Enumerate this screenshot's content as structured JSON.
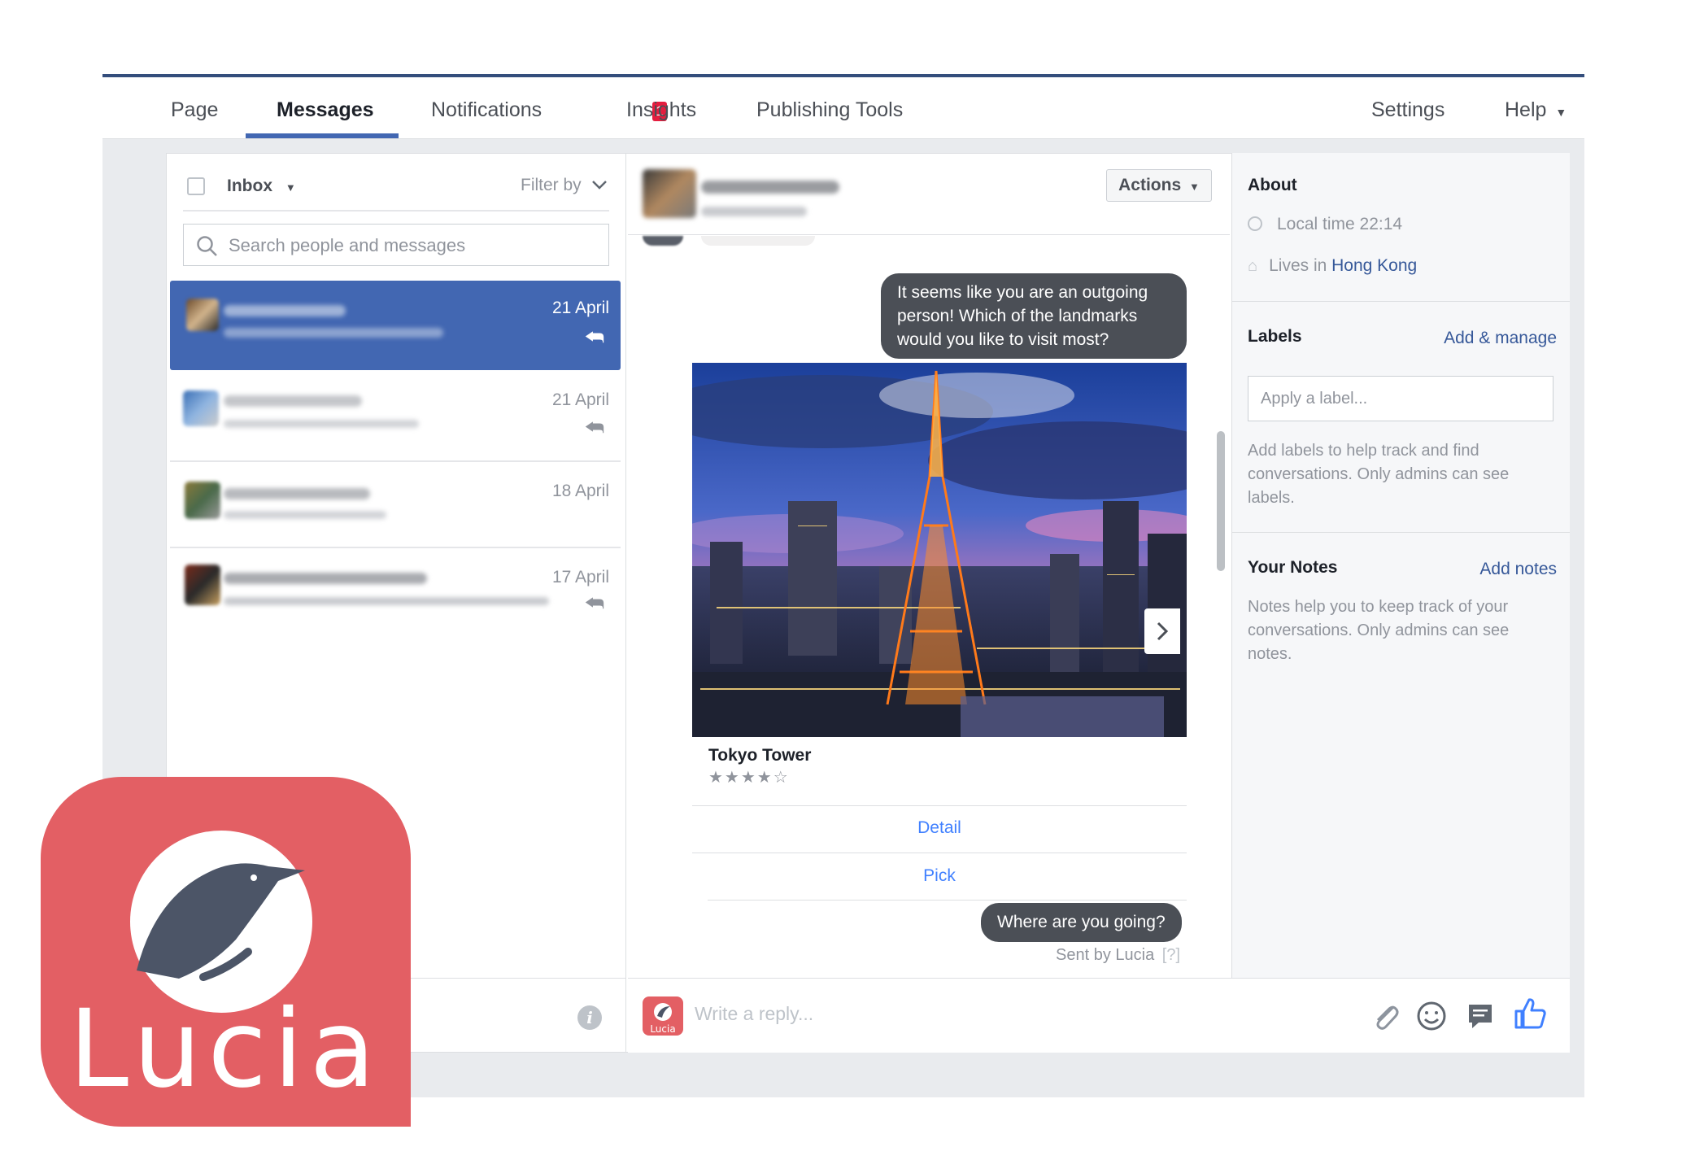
{
  "nav": {
    "tabs": [
      "Page",
      "Messages",
      "Notifications",
      "Insights",
      "Publishing Tools"
    ],
    "notifications_badge": "1",
    "settings": "Settings",
    "help": "Help"
  },
  "inbox": {
    "folder": "Inbox",
    "filter": "Filter by",
    "search_placeholder": "Search people and messages",
    "threads": [
      {
        "date": "21 April",
        "selected": true
      },
      {
        "date": "21 April",
        "selected": false
      },
      {
        "date": "18 April",
        "selected": false
      },
      {
        "date": "17 April",
        "selected": false
      }
    ]
  },
  "conversation": {
    "actions_label": "Actions",
    "bot_message": "It seems like you are an outgoing person! Which of the landmarks would you like to visit most?",
    "card": {
      "title": "Tokyo Tower",
      "rating": "★★★★☆",
      "buttons": [
        "Detail",
        "Pick"
      ]
    },
    "last_message": "Where are you going?",
    "sent_by": "Sent by Lucia",
    "sent_by_help": "[?]",
    "reply_placeholder": "Write a reply..."
  },
  "about": {
    "title": "About",
    "local_time": "Local time 22:14",
    "lives_prefix": "Lives in",
    "lives_city": "Hong Kong"
  },
  "labels": {
    "title": "Labels",
    "add_manage": "Add & manage",
    "input_placeholder": "Apply a label...",
    "help": "Add labels to help track and find conversations. Only admins can see labels."
  },
  "notes": {
    "title": "Your Notes",
    "add_notes": "Add notes",
    "help": "Notes help you to keep track of your conversations. Only admins can see notes."
  },
  "brand": {
    "name": "Lucia",
    "accent": "#e35f64",
    "fb_blue": "#4267b2"
  }
}
